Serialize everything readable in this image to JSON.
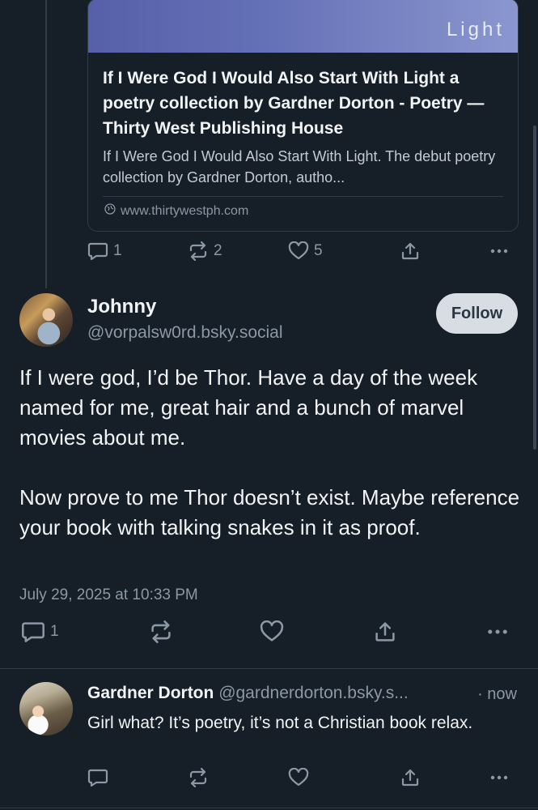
{
  "embed": {
    "image_text": "Light",
    "title": "If I Were God I Would Also Start With Light a poetry collection by Gardner Dorton - Poetry — Thirty West Publishing House",
    "description": "If I Were God I Would Also Start With Light. The debut poetry collection by Gardner Dorton, autho...",
    "domain": "www.thirtywestph.com"
  },
  "quoted_actions": {
    "replies": "1",
    "reposts": "2",
    "likes": "5"
  },
  "post": {
    "author_name": "Johnny",
    "author_handle": "@vorpalsw0rd.bsky.social",
    "follow_label": "Follow",
    "paragraph_1": "If I were god, I’d be Thor. Have a day of the week named for me, great hair and a bunch of marvel movies about me.",
    "paragraph_2": "Now prove to me Thor doesn’t exist. Maybe reference your book with talking snakes in it as proof.",
    "timestamp": "July 29, 2025 at 10:33 PM",
    "replies": "1"
  },
  "reply": {
    "author_name": "Gardner Dorton",
    "author_handle": "@gardnerdorton.bsky.s...",
    "time": "· now",
    "text": "Girl what? It’s poetry, it’s not a Christian book relax."
  },
  "colors": {
    "background": "#161e27",
    "text": "#f1f3f5",
    "muted": "#8b98a5",
    "border": "#2e3b49"
  }
}
